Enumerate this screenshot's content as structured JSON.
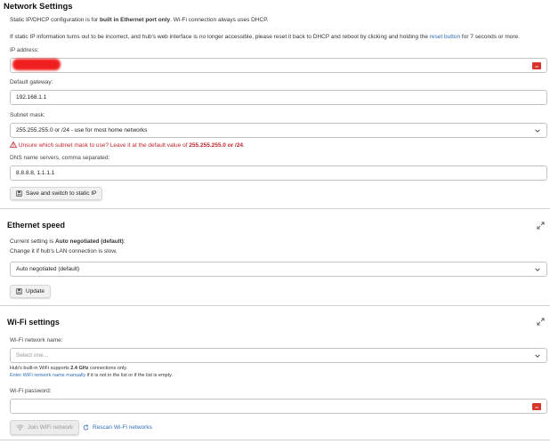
{
  "network": {
    "title": "Network Settings",
    "intro_pre": "Static IP/DHCP configuration is for ",
    "intro_bold": "built in Ethernet port only",
    "intro_post": ". Wi-Fi connection always uses DHCP.",
    "note_pre": "If static IP information turns out to be incorrect, and hub's web interface is no longer accessible, please reset it back to DHCP and reboot by clicking and holding the ",
    "note_link": "reset button",
    "note_post": " for 7 seconds or more.",
    "ip_label": "IP address:",
    "gateway_label": "Default gateway:",
    "gateway_value": "192.168.1.1",
    "subnet_label": "Subnet mask:",
    "subnet_value": "255.255.255.0 or /24 - use for most home networks",
    "subnet_warn_pre": "Unsure which subnet mask to use? Leave it at the default value of ",
    "subnet_warn_bold": "255.255.255.0 or /24",
    "subnet_warn_post": ".",
    "dns_label": "DNS name servers, comma separated:",
    "dns_value": "8.8.8.8, 1.1.1.1",
    "save_button": "Save and switch to static IP"
  },
  "ethernet": {
    "title": "Ethernet speed",
    "current_pre": "Current setting is ",
    "current_bold": "Auto negotiated (default)",
    "current_post": ":",
    "hint": "Change it if hub's LAN connection is slow.",
    "select_value": "Auto negotiated (default)",
    "update_button": "Update"
  },
  "wifi": {
    "title": "Wi-Fi settings",
    "name_label": "Wi-Fi network name:",
    "name_placeholder": "Select one...",
    "support_pre": "Hub's built-in WiFi supports ",
    "support_bold": "2.4 GHz",
    "support_post": " connections only.",
    "manual_link": "Enter WiFi network name manually",
    "manual_post": " if it is not in the list or if the list is empty.",
    "password_label": "Wi-Fi password:",
    "join_button": "Join WiFi network",
    "rescan_button": "Rescan Wi-Fi networks"
  },
  "icons": {
    "password_manager": "password-manager-icon",
    "expand": "collapse-icon",
    "chevron": "chevron-down-icon"
  },
  "colors": {
    "link": "#2f6db5",
    "warning": "#c0262b",
    "password_icon": "#d9342b"
  }
}
